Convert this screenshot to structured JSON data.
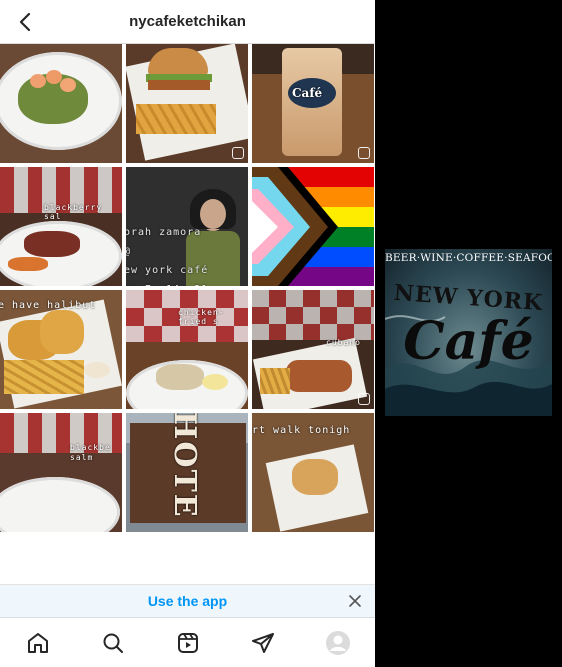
{
  "header": {
    "handle": "nycafeketchikan"
  },
  "posts": [
    {
      "caption": ""
    },
    {
      "caption": ""
    },
    {
      "caption": "Café"
    },
    {
      "caption": "blackberry sal"
    },
    {
      "caption": "orah zamora\n@\new york café\nne 7, 14, 21"
    },
    {
      "caption": ""
    },
    {
      "caption": "e have halibut"
    },
    {
      "caption": "chicken-fried s"
    },
    {
      "caption": "cubano"
    },
    {
      "caption": "blackbe\nsalm"
    },
    {
      "caption": "HOTE"
    },
    {
      "caption": "rt walk tonigh"
    }
  ],
  "banner": {
    "label": "Use the app"
  },
  "side_logo": {
    "tagline": "BEER·WINE·COFFEE·SEAFOOD",
    "line1": "NEW YORK",
    "line2": "Café"
  },
  "colors": {
    "accent": "#0095f6",
    "background": "#000000"
  },
  "nav": [
    "home-icon",
    "search-icon",
    "reels-icon",
    "send-icon",
    "profile-avatar"
  ]
}
